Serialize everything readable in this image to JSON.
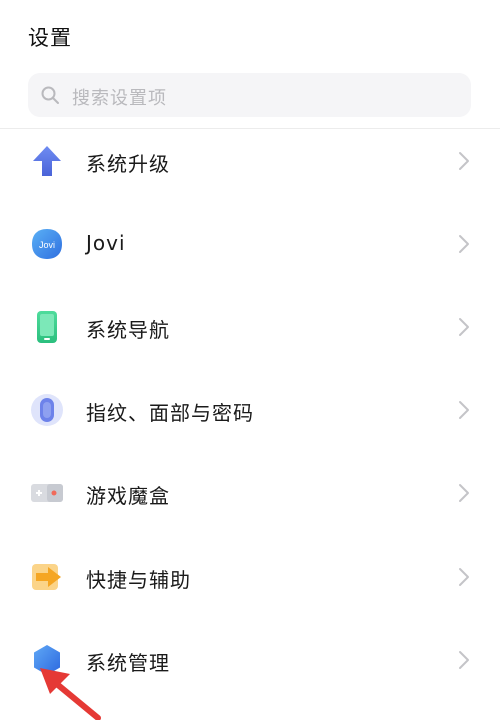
{
  "header": {
    "title": "设置"
  },
  "search": {
    "placeholder": "搜索设置项"
  },
  "items": [
    {
      "label": "系统升级",
      "icon": "system-update-icon"
    },
    {
      "label": "Jovi",
      "icon": "jovi-icon",
      "icon_text": "Jovi"
    },
    {
      "label": "系统导航",
      "icon": "system-navigation-icon"
    },
    {
      "label": "指纹、面部与密码",
      "icon": "fingerprint-icon"
    },
    {
      "label": "游戏魔盒",
      "icon": "game-box-icon"
    },
    {
      "label": "快捷与辅助",
      "icon": "shortcut-icon"
    },
    {
      "label": "系统管理",
      "icon": "system-management-icon"
    }
  ],
  "annotation": {
    "arrow_color": "#e53935"
  },
  "colors": {
    "accent_blue": "#5b7ce6",
    "green": "#3ecf8e",
    "orange": "#f5a623"
  }
}
